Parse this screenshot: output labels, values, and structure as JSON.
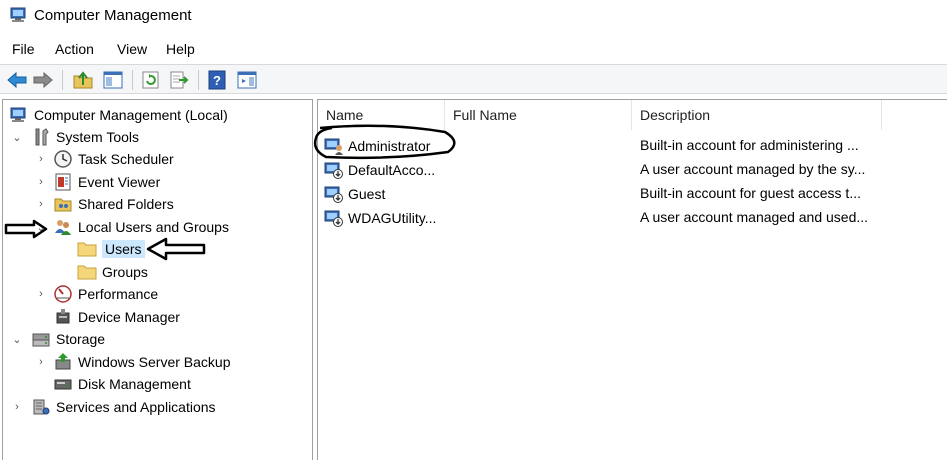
{
  "window": {
    "title": "Computer Management"
  },
  "menu": [
    "File",
    "Action",
    "View",
    "Help"
  ],
  "toolbar": {
    "buttons": [
      "back-arrow-icon",
      "forward-arrow-icon",
      "up-folder-icon",
      "show-hide-tree-icon",
      "refresh-icon",
      "export-list-icon",
      "help-icon",
      "show-hide-action-pane-icon"
    ]
  },
  "tree": {
    "root": "Computer Management (Local)",
    "system_tools": "System Tools",
    "task_scheduler": "Task Scheduler",
    "event_viewer": "Event Viewer",
    "shared_folders": "Shared Folders",
    "local_users_groups": "Local Users and Groups",
    "users": "Users",
    "groups": "Groups",
    "performance": "Performance",
    "device_manager": "Device Manager",
    "storage": "Storage",
    "windows_server_backup": "Windows Server Backup",
    "disk_management": "Disk Management",
    "services_apps": "Services and Applications"
  },
  "list": {
    "columns": [
      "Name",
      "Full Name",
      "Description"
    ],
    "rows": [
      {
        "name": "Administrator",
        "full_name": "",
        "description": "Built-in account for administering ..."
      },
      {
        "name": "DefaultAcco...",
        "full_name": "",
        "description": "A user account managed by the sy..."
      },
      {
        "name": "Guest",
        "full_name": "",
        "description": "Built-in account for guest access t..."
      },
      {
        "name": "WDAGUtility...",
        "full_name": "",
        "description": "A user account managed and used..."
      }
    ]
  },
  "colors": {
    "selection": "#cce8ff",
    "pane_border": "#a0a0a0",
    "toolbar_bg": "#f5f6f7"
  }
}
